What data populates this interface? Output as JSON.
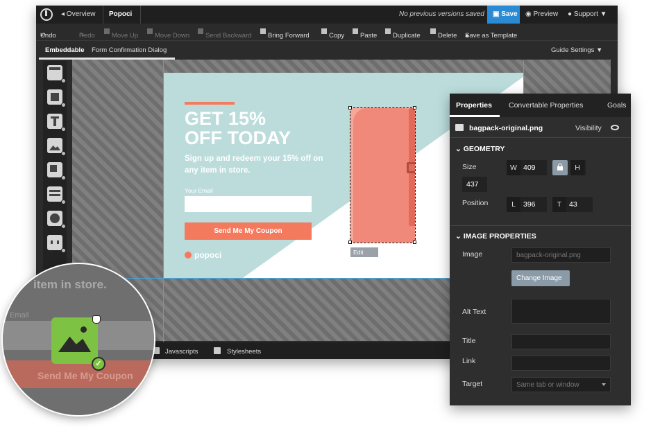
{
  "topbar": {
    "back_label": "◂ Overview",
    "project_name": "Popoci",
    "versions_text": "No previous versions saved",
    "save_label": "Save",
    "preview_label": "Preview",
    "support_label": "Support"
  },
  "toolbar": {
    "undo": "Undo",
    "redo": "Redo",
    "move_up": "Move Up",
    "move_down": "Move Down",
    "send_backward": "Send Backward",
    "bring_forward": "Bring Forward",
    "copy": "Copy",
    "paste": "Paste",
    "duplicate": "Duplicate",
    "delete": "Delete",
    "save_template": "Save as Template"
  },
  "tabs": {
    "embeddable": "Embeddable",
    "form_confirmation": "Form Confirmation Dialog",
    "guide_settings": "Guide Settings"
  },
  "popup": {
    "headline_line1": "GET 15%",
    "headline_line2": "OFF TODAY",
    "subtitle": "Sign up and redeem your 15% off on any item in store.",
    "email_label": "Your Email",
    "cta": "Send Me My Coupon",
    "brand": "popoci",
    "edit_tag": "Edit"
  },
  "bottombar": {
    "javascripts": "Javascripts",
    "stylesheets": "Stylesheets"
  },
  "panel": {
    "tab_properties": "Properties",
    "tab_convertable": "Convertable Properties",
    "tab_goals": "Goals",
    "filename": "bagpack-original.png",
    "visibility": "Visibility",
    "geometry_title": "GEOMETRY",
    "size_label": "Size",
    "w_key": "W",
    "w_value": "409",
    "h_key": "H",
    "h_value": "437",
    "position_label": "Position",
    "l_key": "L",
    "l_value": "396",
    "t_key": "T",
    "t_value": "43",
    "image_props_title": "IMAGE PROPERTIES",
    "image_label": "Image",
    "image_value": "bagpack-original.png",
    "change_image": "Change Image",
    "alt_label": "Alt Text",
    "title_label": "Title",
    "link_label": "Link",
    "target_label": "Target",
    "target_value": "Same tab or window"
  },
  "magnifier": {
    "text_in_store": "item in store.",
    "email_label": "Email",
    "cta": "Send Me My Coupon"
  },
  "colors": {
    "accent": "#2a8ad4",
    "coral": "#f47a5e",
    "teal": "#bcdcdc",
    "image_green": "#7dc242"
  }
}
